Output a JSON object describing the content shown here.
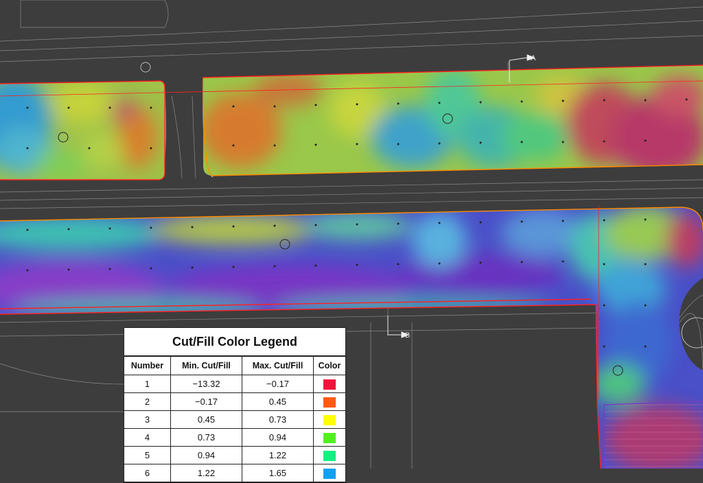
{
  "legend": {
    "title": "Cut/Fill Color Legend",
    "headers": [
      "Number",
      "Min. Cut/Fill",
      "Max. Cut/Fill",
      "Color"
    ],
    "rows": [
      {
        "number": "1",
        "min": "−13.32",
        "max": "−0.17",
        "color": "#f0143c"
      },
      {
        "number": "2",
        "min": "−0.17",
        "max": "0.45",
        "color": "#ff5a14"
      },
      {
        "number": "3",
        "min": "0.45",
        "max": "0.73",
        "color": "#ffff00"
      },
      {
        "number": "4",
        "min": "0.73",
        "max": "0.94",
        "color": "#50f01e"
      },
      {
        "number": "5",
        "min": "0.94",
        "max": "1.22",
        "color": "#14f080"
      },
      {
        "number": "6",
        "min": "1.22",
        "max": "1.65",
        "color": "#14a0f0"
      }
    ]
  },
  "map_labels": {
    "section_a": "A",
    "section_b": "B"
  },
  "colors": {
    "background": "#3d3d3d",
    "linework": "#8a8a8a",
    "boundary": "#ff2020",
    "offset": "#ff8a00"
  }
}
